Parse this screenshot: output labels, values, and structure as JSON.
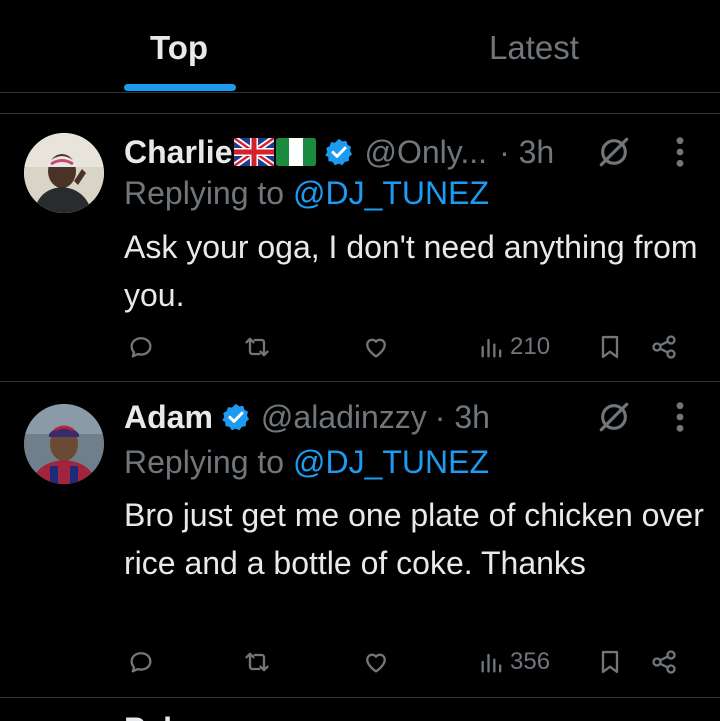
{
  "tabs": [
    {
      "label": "Top",
      "active": true
    },
    {
      "label": "Latest",
      "active": false
    }
  ],
  "accent_color": "#1d9bf0",
  "replies": [
    {
      "display_name": "Charlie",
      "flags": [
        "united-kingdom-flag",
        "nigeria-flag"
      ],
      "verified": true,
      "handle": "@Only...",
      "time": "· 3h",
      "replying_prefix": "Replying to",
      "replying_to": "@DJ_TUNEZ",
      "text": "Ask your oga, I don't need anything from you.",
      "views": "210"
    },
    {
      "display_name": "Adam",
      "flags": [],
      "verified": true,
      "handle": "@aladinzzy",
      "time": "· 3h",
      "replying_prefix": "Replying to",
      "replying_to": "@DJ_TUNEZ",
      "text": "Bro just get me one plate of chicken over rice and a bottle of coke. Thanks",
      "views": "356"
    }
  ],
  "next_reply_partial": "Pab",
  "icons": [
    "reply-icon",
    "retweet-icon",
    "like-icon",
    "views-icon",
    "bookmark-icon",
    "share-icon",
    "grok-icon",
    "more-icon",
    "verified-badge-icon"
  ]
}
